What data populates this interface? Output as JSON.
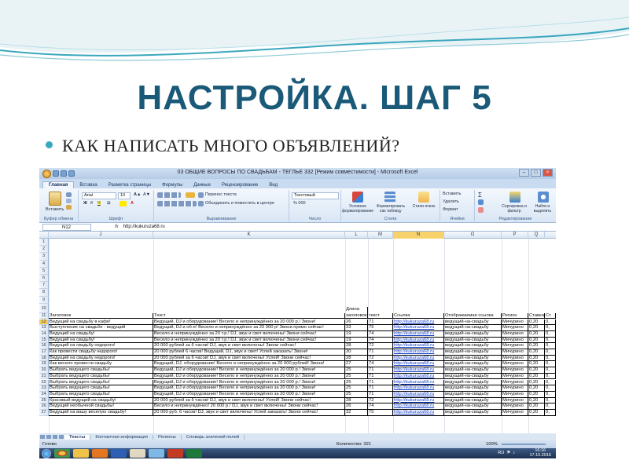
{
  "slide": {
    "title": "НАСТРОЙКА. ШАГ 5",
    "bullet": "КАК НАПИСАТЬ МНОГО ОБЪЯВЛЕНИЙ?",
    "accent_color": "#1a5a78",
    "bullet_color": "#36a9bd"
  },
  "window": {
    "title": "03 ОБЩИЕ ВОПРОСЫ ПО СВАДЬБАМ - ТЕГЛЬЕ 332 [Режим совместимости] - Microsoft Excel"
  },
  "ribbon": {
    "tabs": [
      "Главная",
      "Вставка",
      "Разметка страницы",
      "Формулы",
      "Данные",
      "Рецензирование",
      "Вид"
    ],
    "paste": "Вставить",
    "clipboard_group": "Буфер обмена",
    "font_name": "Arial",
    "font_size": "10",
    "font_group": "Шрифт",
    "wrap_text": "Перенос текста",
    "merge_center": "Объединить и поместить в центре",
    "alignment_group": "Выравнивание",
    "number_format": "Текстовый",
    "percent_format": "% 000",
    "number_group": "Число",
    "conditional_formatting": "Условное форматирование",
    "format_as_table": "Форматировать как таблицу",
    "cell_styles": "Стили ячеек",
    "styles_group": "Стили",
    "insert": "Вставить",
    "delete": "Удалить",
    "format": "Формат",
    "cells_group": "Ячейки",
    "sort_filter": "Сортировка и фильтр",
    "find_select": "Найти и выделить",
    "editing_group": "Редактирование"
  },
  "formula_bar": {
    "cell_ref": "N12",
    "fx": "fx",
    "value": "http://kukuruza68.ru"
  },
  "grid": {
    "columns": [
      "J",
      "K",
      "L",
      "M",
      "N",
      "O",
      "P",
      "Q"
    ],
    "selected_column": "N",
    "empty_rows": [
      "1",
      "2",
      "3",
      "4",
      "5",
      "6",
      "7",
      "8",
      "9",
      "10"
    ],
    "header_row10": {
      "length_label": "Длина"
    },
    "header_row11": {
      "row": "11",
      "j": "Заголовок",
      "k": "Текст",
      "l": "заголовок",
      "m": "текст",
      "n": "Ссылка",
      "o": "Отображаемая ссылка",
      "p": "Регион",
      "q": "Ставка",
      "r": "Ст"
    },
    "rows": [
      {
        "row": "12",
        "j": "Ведущий на свадьбу в кафе!",
        "k": "Ведущий, DJ и оборудование! Весело и непринуждённо за 20 000 р.! Звони!",
        "l": "26",
        "m": "71",
        "n": "http://kukuruza68.ru",
        "o": "ведущий-на-свадьбу",
        "p": "Мичурино",
        "q": "0,20",
        "r": "0,"
      },
      {
        "row": "13",
        "j": "Выступление на свадьбе - ведущий",
        "k": "Ведущий, DJ и об-е! Весело и непринуждённо за 20 000 р! Звони прямо сейчас!",
        "l": "33",
        "m": "75",
        "n": "http://kukuruza68.ru",
        "o": "ведущий-на-свадьбу",
        "p": "Мичурино",
        "q": "0,20",
        "r": "0,"
      },
      {
        "row": "14",
        "j": "Ведущий на свадьбу!",
        "k": "Весело и непринуждённо за 20 т.р.! DJ, звук и свет включены! Звони сейчас!",
        "l": "19",
        "m": "74",
        "n": "http://kukuruza68.ru",
        "o": "ведущий-на-свадьбу",
        "p": "Мичурино",
        "q": "0,20",
        "r": "0,"
      },
      {
        "row": "15",
        "j": "Ведущий на свадьбу!",
        "k": "Весело и непринуждённо за 20 т.р.! DJ, звук и свет включены! Звони сейчас!",
        "l": "19",
        "m": "74",
        "n": "http://kukuruza68.ru",
        "o": "ведущий-на-свадьбу",
        "p": "Мичурино",
        "q": "0,20",
        "r": "0,"
      },
      {
        "row": "16",
        "j": "Ведущий на свадьбу недорого!",
        "k": "20 000 рублей за 6 часов! DJ, звук и свет включены! Звони сейчас!",
        "l": "28",
        "m": "72",
        "n": "http://kukuruza68.ru",
        "o": "ведущий-на-свадьбу",
        "p": "Мичурино",
        "q": "0,20",
        "r": "0,"
      },
      {
        "row": "17",
        "j": "Как провести свадьбу недорого!",
        "k": "20 000 рублей 6 часов! Ведущий, DJ, звук и свет! Успей заказать! Звони!",
        "l": "30",
        "m": "71",
        "n": "http://kukuruza68.ru",
        "o": "ведущий-на-свадьбу",
        "p": "Мичурино",
        "q": "0,20",
        "r": "0,"
      },
      {
        "row": "18",
        "j": "Ведущий на свадьбу недорого!",
        "k": "20 000 рублей за 6 часов! DJ, звук и свет включены! Успей! Звони сейчас!",
        "l": "28",
        "m": "72",
        "n": "http://kukuruza68.ru",
        "o": "ведущий-на-свадьбу",
        "p": "Мичурино",
        "q": "0,20",
        "r": "0,"
      },
      {
        "row": "19",
        "j": "Как весело провести свадьбу",
        "k": "Ведущий, DJ, оборудование! Весело и непринуждённо за 20 000 рублей! Звони!",
        "l": "27",
        "m": "74",
        "n": "http://kukuruza68.ru",
        "o": "ведущий-на-свадьбу",
        "p": "Мичурино",
        "q": "0,20",
        "r": "0,"
      },
      {
        "row": "20",
        "j": "Выбрать ведущего свадьбы!",
        "k": "Ведущий, DJ и оборудование! Весело и непринуждённо за 20 000 р.! Звони!",
        "l": "25",
        "m": "71",
        "n": "http://kukuruza68.ru",
        "o": "ведущий-на-свадьбу",
        "p": "Мичурино",
        "q": "0,20",
        "r": "0,"
      },
      {
        "row": "21",
        "j": "Выбрать ведущего свадьбы!",
        "k": "Ведущий, DJ и оборудование! Весело и непринуждённо за 20 000 р.! Звони!",
        "l": "25",
        "m": "71",
        "n": "http://kukuruza68.ru",
        "o": "ведущий-на-свадьбу",
        "p": "Мичурино",
        "q": "0,20",
        "r": "0,"
      },
      {
        "row": "22",
        "j": "Выбрать ведущего свадьбы!",
        "k": "Ведущий, DJ и оборудование! Весело и непринуждённо за 20 000 р.! Звони!",
        "l": "25",
        "m": "71",
        "n": "http://kukuruza68.ru",
        "o": "ведущий-на-свадьбу",
        "p": "Мичурино",
        "q": "0,20",
        "r": "0,"
      },
      {
        "row": "23",
        "j": "Выбрать ведущего свадьбы!",
        "k": "Ведущий, DJ и оборудование! Весело и непринуждённо за 20 000 р.! Звони!",
        "l": "25",
        "m": "71",
        "n": "http://kukuruza68.ru",
        "o": "ведущий-на-свадьбу",
        "p": "Мичурино",
        "q": "0,20",
        "r": "0,"
      },
      {
        "row": "24",
        "j": "Выбрать ведущего свадьбы!",
        "k": "Ведущий, DJ и оборудование! Весело и непринуждённо за 20 000 р.! Звони!",
        "l": "25",
        "m": "71",
        "n": "http://kukuruza68.ru",
        "o": "ведущий-на-свадьбу",
        "p": "Мичурино",
        "q": "0,20",
        "r": "0,"
      },
      {
        "row": "25",
        "j": "Красивый ведущий на свадьбу!",
        "k": "20 000 рублей за 6 часов! DJ, звук и свет включены! Успей! Звони сейчас!",
        "l": "28",
        "m": "72",
        "n": "http://kukuruza68.ru",
        "o": "ведущий-на-свадьбу",
        "p": "Мичурино",
        "q": "0,20",
        "r": "0,"
      },
      {
        "row": "26",
        "j": "Ведущий необычной свадьбы!",
        "k": "Весело и непринуждённо! 20 000 р.! DJ, звук и свет включены! Звони сейчас!",
        "l": "26",
        "m": "74",
        "n": "http://kukuruza68.ru",
        "o": "ведущий-на-свадьбу",
        "p": "Мичурино",
        "q": "0,20",
        "r": "0,"
      },
      {
        "row": "27",
        "j": "Ведущий на вашу веселую свадьбу!",
        "k": "20 000 руб. 6 часов! DJ, звук и свет включены! Успей заказать! Звони сейчас!",
        "l": "32",
        "m": "75",
        "n": "http://kukuruza68.ru",
        "o": "ведущий-на-свадьбу",
        "p": "Мичурино",
        "q": "0,20",
        "r": "0,"
      }
    ],
    "selected_row": "12"
  },
  "sheets": [
    "Тексты",
    "Контактная информация",
    "Регионы",
    "Словарь значений полей"
  ],
  "active_sheet": "Тексты",
  "status": {
    "ready": "Готово",
    "count": "Количество: 321",
    "zoom": "100%"
  },
  "taskbar": {
    "tray_lang": "RU",
    "time": "16:16",
    "date": "17.10.2016"
  }
}
